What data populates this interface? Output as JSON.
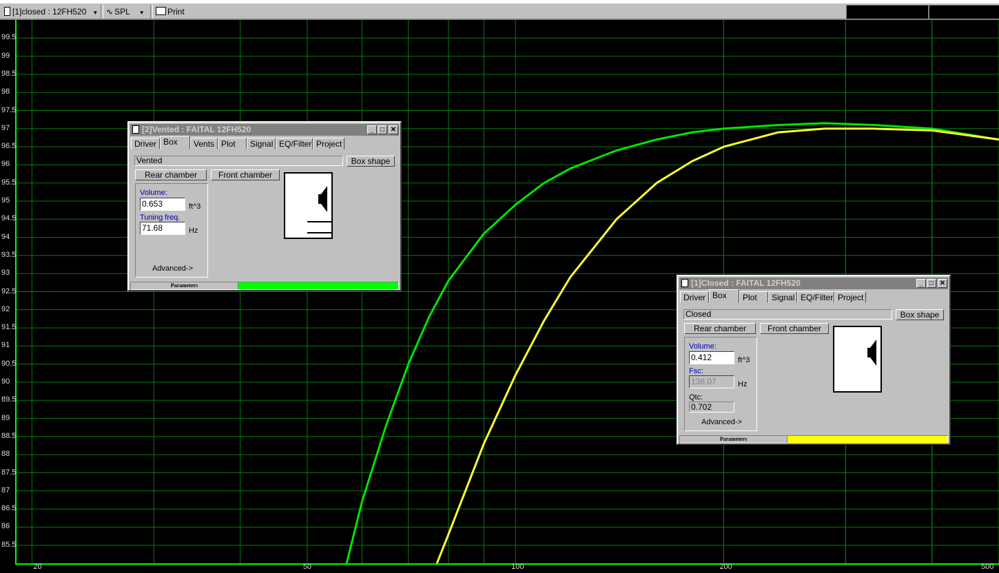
{
  "toolbar": {
    "project_label": "[1]closed : 12FH520",
    "plot_label": "SPL",
    "print_label": "Print"
  },
  "chart_data": {
    "type": "line",
    "xlabel": "",
    "ylabel": "",
    "x_scale": "log",
    "xlim": [
      19,
      500
    ],
    "ylim": [
      85.0,
      100.0
    ],
    "x_ticks": [
      "20",
      "50",
      "100",
      "200",
      "500"
    ],
    "y_ticks": [
      "99.5",
      "99",
      "98.5",
      "98",
      "97.5",
      "97",
      "96.5",
      "96",
      "95.5",
      "95",
      "94.5",
      "94",
      "93.5",
      "93",
      "92.5",
      "92",
      "91.5",
      "91",
      "90.5",
      "90",
      "89.5",
      "89",
      "88.5",
      "88",
      "87.5",
      "87",
      "86.5",
      "86",
      "85.5"
    ],
    "grid": true,
    "series": [
      {
        "color": "#00e600",
        "x": [
          57,
          60,
          65,
          70,
          75,
          80,
          90,
          100,
          110,
          120,
          140,
          160,
          180,
          200,
          240,
          280,
          330,
          400,
          500
        ],
        "y": [
          85.0,
          86.7,
          88.8,
          90.5,
          91.8,
          92.8,
          94.1,
          94.9,
          95.5,
          95.9,
          96.4,
          96.7,
          96.9,
          97.0,
          97.1,
          97.15,
          97.1,
          97.0,
          96.7
        ]
      },
      {
        "color": "#ffff33",
        "x": [
          77,
          80,
          90,
          100,
          110,
          120,
          140,
          160,
          180,
          200,
          240,
          280,
          330,
          400,
          500
        ],
        "y": [
          85.0,
          85.8,
          88.3,
          90.2,
          91.7,
          92.9,
          94.5,
          95.5,
          96.1,
          96.5,
          96.9,
          97.0,
          97.0,
          96.95,
          96.7
        ]
      }
    ]
  },
  "vented_window": {
    "title": "[2]Vented : FAITAL 12FH520",
    "tabs": [
      "Driver",
      "Box",
      "Vents",
      "Plot",
      "Signal",
      "EQ/Filter",
      "Project"
    ],
    "box_type": "Vented",
    "box_shape_btn": "Box shape",
    "rear_chamber_btn": "Rear chamber",
    "front_chamber_btn": "Front chamber",
    "volume_label": "Volume:",
    "volume_value": "0.653",
    "volume_unit": "ft^3",
    "tuning_label": "Tuning freq.",
    "tuning_value": "71.68",
    "tuning_unit": "Hz",
    "advanced": "Advanced->",
    "status_label": "Parameters",
    "status_color": "#00ff00"
  },
  "closed_window": {
    "title": "[1]Closed : FAITAL 12FH520",
    "tabs": [
      "Driver",
      "Box",
      "Plot",
      "Signal",
      "EQ/Filter",
      "Project"
    ],
    "box_type": "Closed",
    "box_shape_btn": "Box shape",
    "rear_chamber_btn": "Rear chamber",
    "front_chamber_btn": "Front chamber",
    "volume_label": "Volume:",
    "volume_value": "0.412",
    "volume_unit": "ft^3",
    "fsc_label": "Fsc:",
    "fsc_value": "136.07",
    "fsc_unit": "Hz",
    "qtc_label": "Qtc:",
    "qtc_value": "0.702",
    "advanced": "Advanced->",
    "status_label": "Parameters",
    "status_color": "#ffff00"
  }
}
